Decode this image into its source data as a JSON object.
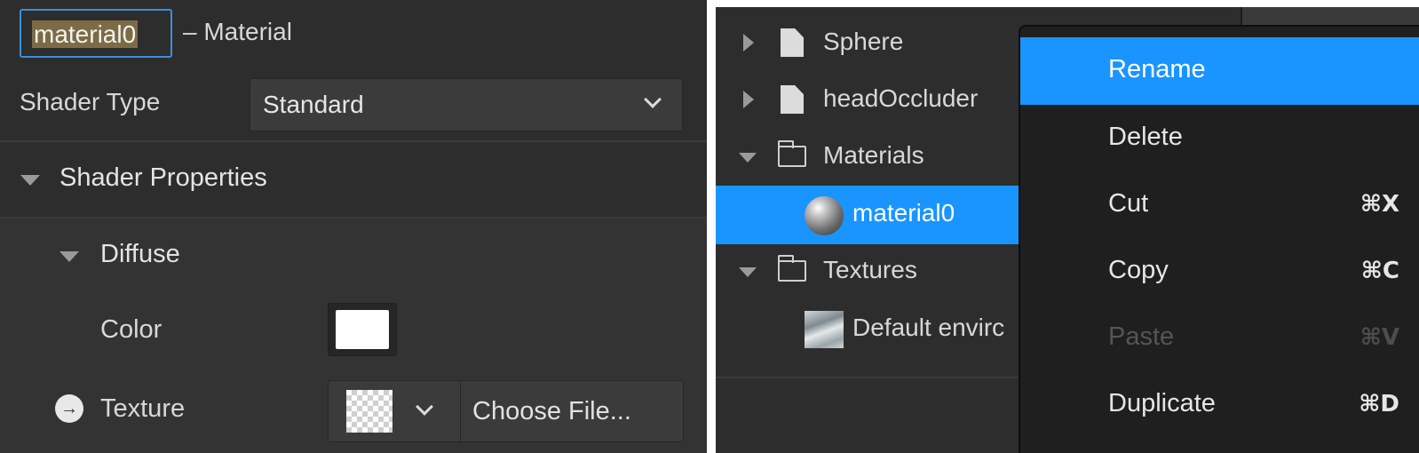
{
  "inspector": {
    "name_value": "material0",
    "name_suffix": "– Material",
    "shader_type_label": "Shader Type",
    "shader_type_value": "Standard",
    "shader_properties_label": "Shader Properties",
    "diffuse_label": "Diffuse",
    "color_label": "Color",
    "color_value": "#ffffff",
    "texture_label": "Texture",
    "choose_file_label": "Choose File..."
  },
  "hierarchy": {
    "items": [
      {
        "label": "Sphere",
        "icon": "file-icon",
        "expander": "collapsed"
      },
      {
        "label": "headOccluder",
        "icon": "file-icon",
        "expander": "collapsed"
      },
      {
        "label": "Materials",
        "icon": "folder-icon",
        "expander": "expanded"
      },
      {
        "label": "material0",
        "icon": "sphere-icon",
        "selected": true
      },
      {
        "label": "Textures",
        "icon": "folder-icon",
        "expander": "expanded"
      },
      {
        "label": "Default envirc",
        "icon": "texture-thumbnail-icon"
      }
    ]
  },
  "context_menu": {
    "items": [
      {
        "label": "Rename",
        "shortcut": "",
        "state": "highlighted"
      },
      {
        "label": "Delete",
        "shortcut": "",
        "state": "enabled"
      },
      {
        "label": "Cut",
        "shortcut": "⌘X",
        "state": "enabled"
      },
      {
        "label": "Copy",
        "shortcut": "⌘C",
        "state": "enabled"
      },
      {
        "label": "Paste",
        "shortcut": "⌘V",
        "state": "disabled"
      },
      {
        "label": "Duplicate",
        "shortcut": "⌘D",
        "state": "enabled"
      }
    ]
  },
  "colors": {
    "panel_bg": "#2d2d2d",
    "accent_blue": "#1a94ff",
    "menu_bg": "#1f1f1f",
    "name_selection": "#7d6b45"
  }
}
